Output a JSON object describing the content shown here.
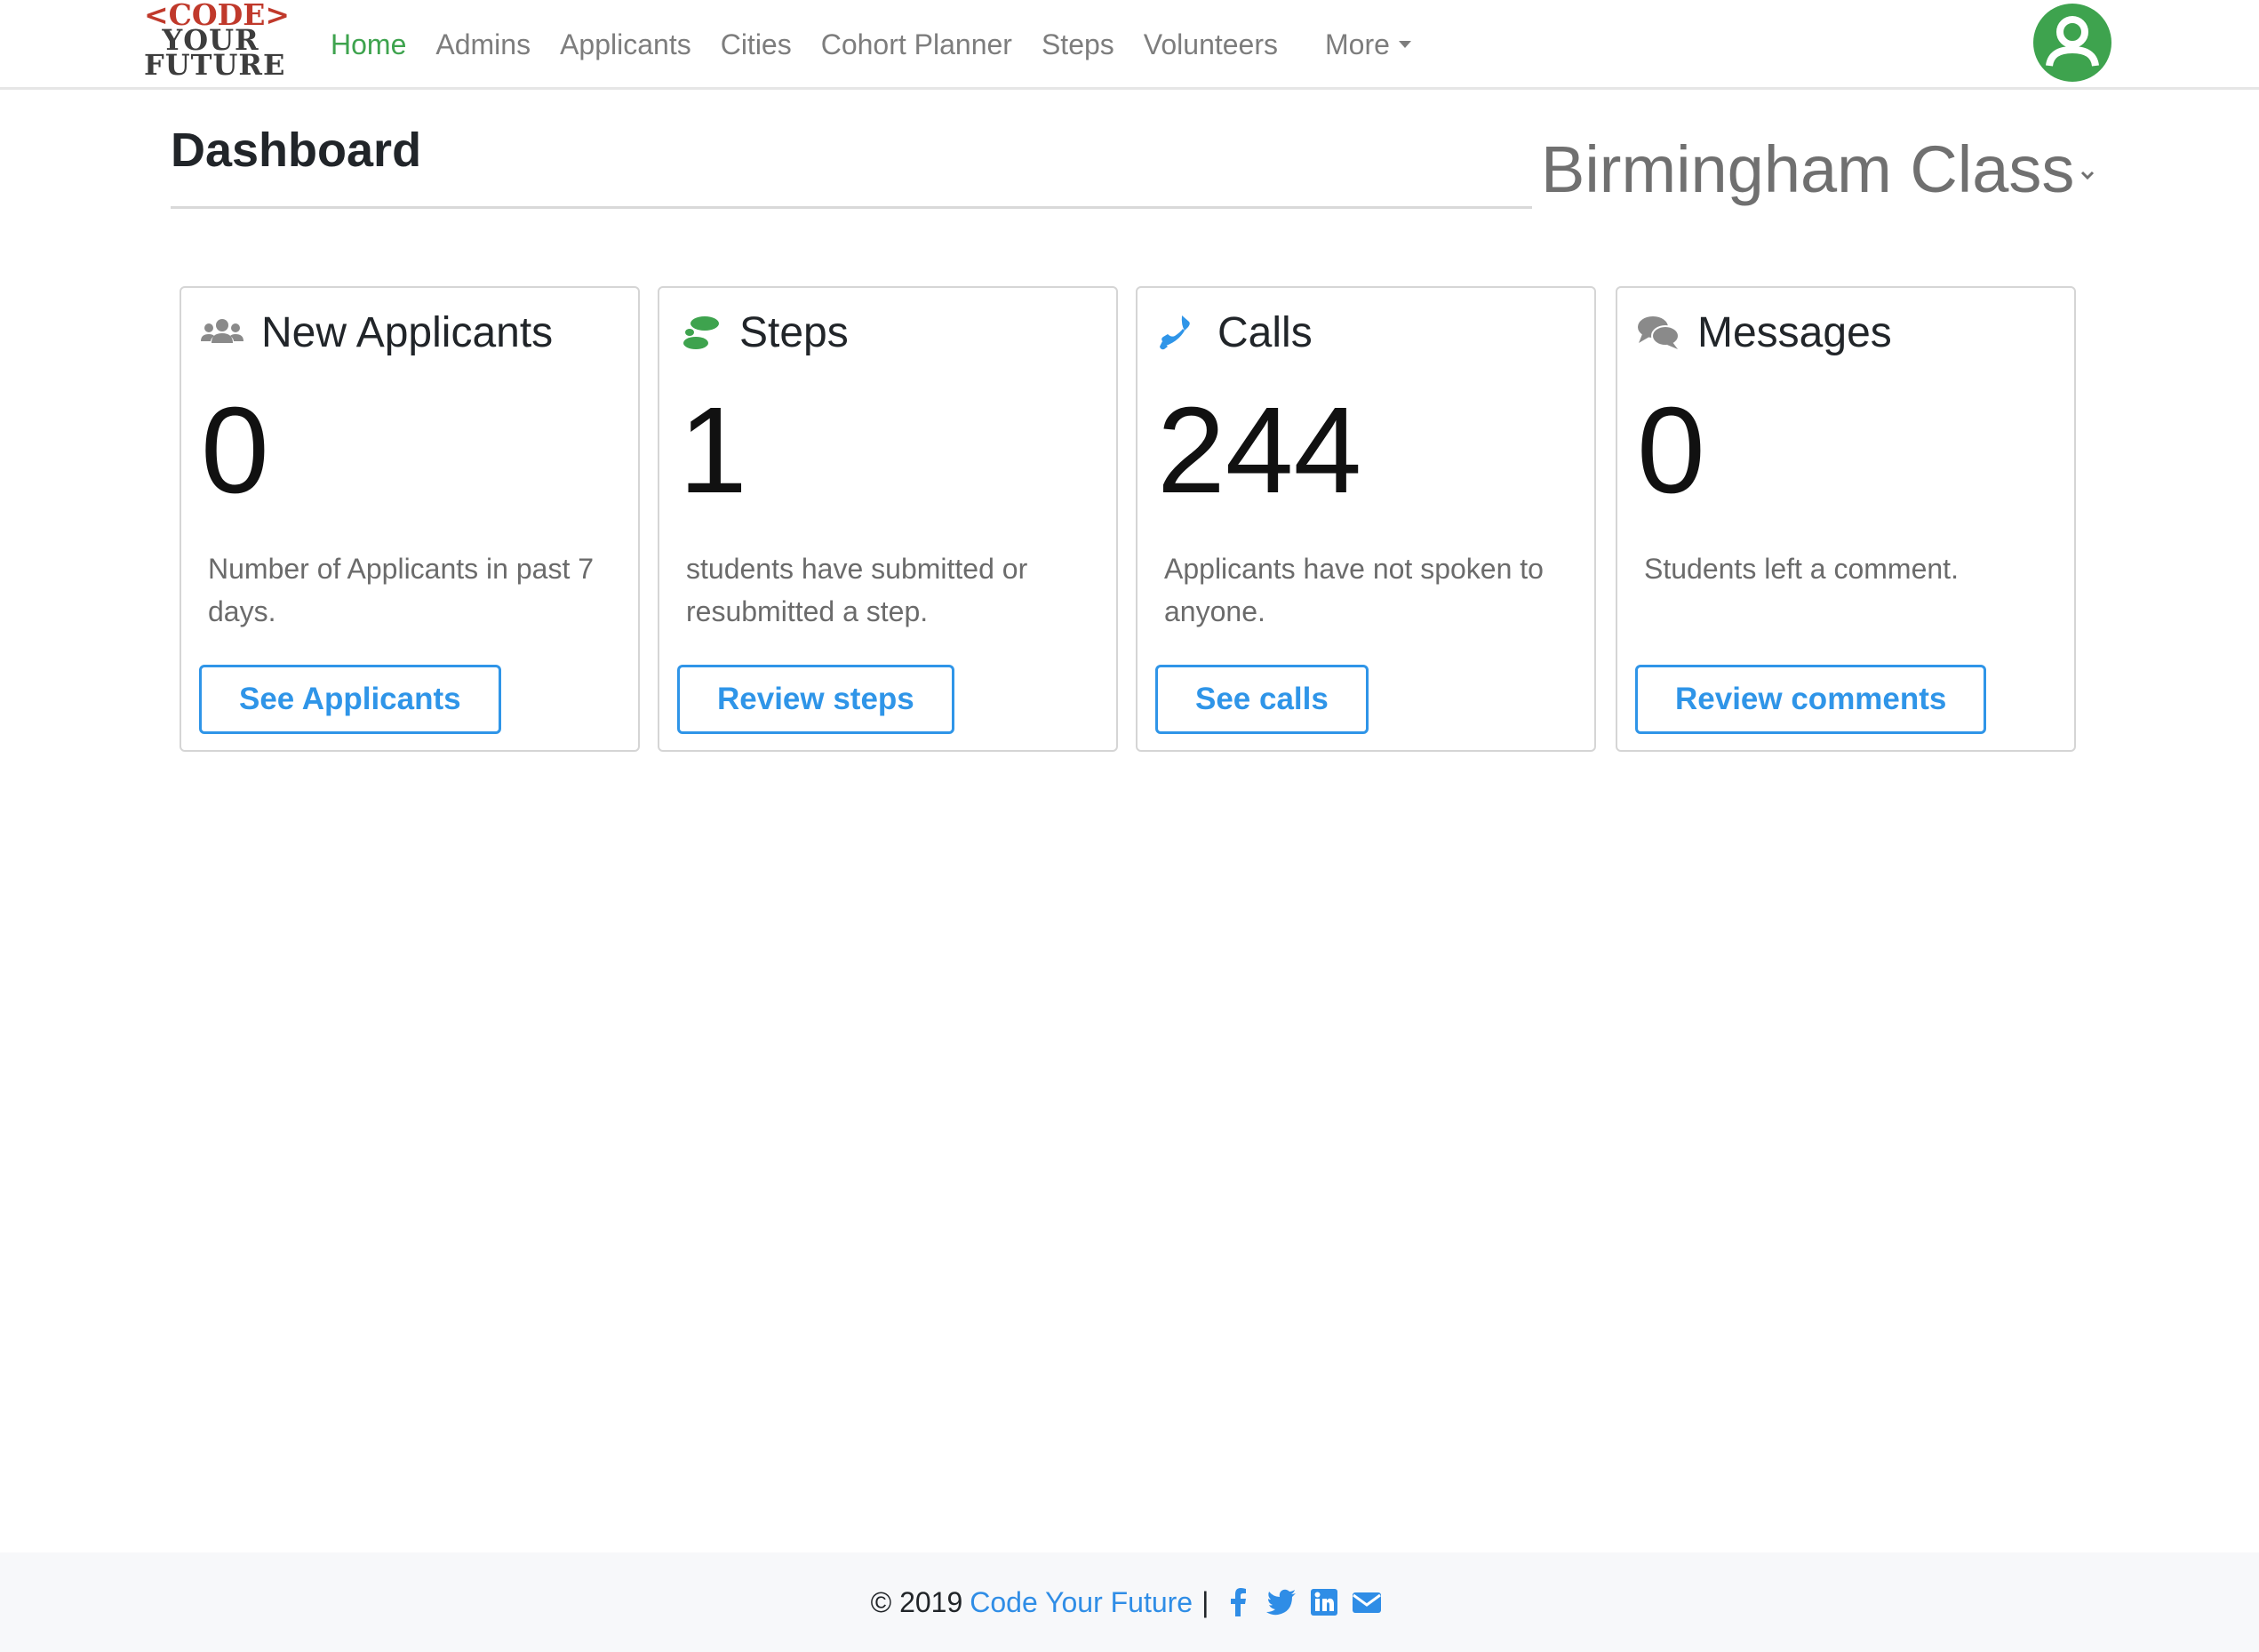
{
  "logo": {
    "line1": "<CODE>",
    "line2": "YOUR",
    "line3": "FUTURE"
  },
  "nav": {
    "items": [
      {
        "label": "Home",
        "active": true
      },
      {
        "label": "Admins"
      },
      {
        "label": "Applicants"
      },
      {
        "label": "Cities"
      },
      {
        "label": "Cohort Planner"
      },
      {
        "label": "Steps"
      },
      {
        "label": "Volunteers"
      }
    ],
    "more_label": "More",
    "avatar_icon": "user-circle-icon",
    "accent_color": "#3ea34e"
  },
  "page": {
    "title": "Dashboard",
    "city_select": "Birmingham Class"
  },
  "cards": [
    {
      "title": "New Applicants",
      "icon": "users-icon",
      "count": "0",
      "description": "Number of Applicants in past 7 days.",
      "button": "See Applicants"
    },
    {
      "title": "Steps",
      "icon": "footsteps-icon",
      "count": "1",
      "description": "students have submitted or resubmitted a step.",
      "button": "Review steps"
    },
    {
      "title": "Calls",
      "icon": "phone-icon",
      "count": "244",
      "description": "Applicants have not spoken to anyone.",
      "button": "See calls"
    },
    {
      "title": "Messages",
      "icon": "comments-icon",
      "count": "0",
      "description": "Students left a comment.",
      "button": "Review comments"
    }
  ],
  "footer": {
    "copyright": "© 2019",
    "link": "Code Your Future",
    "separator": "|",
    "social_icons": [
      "facebook-icon",
      "twitter-icon",
      "linkedin-icon",
      "email-icon"
    ]
  },
  "colors": {
    "button": "#2f95e8",
    "link": "#2f8de6",
    "steps_icon": "#3ea34e",
    "calls_icon": "#2f95e8"
  }
}
